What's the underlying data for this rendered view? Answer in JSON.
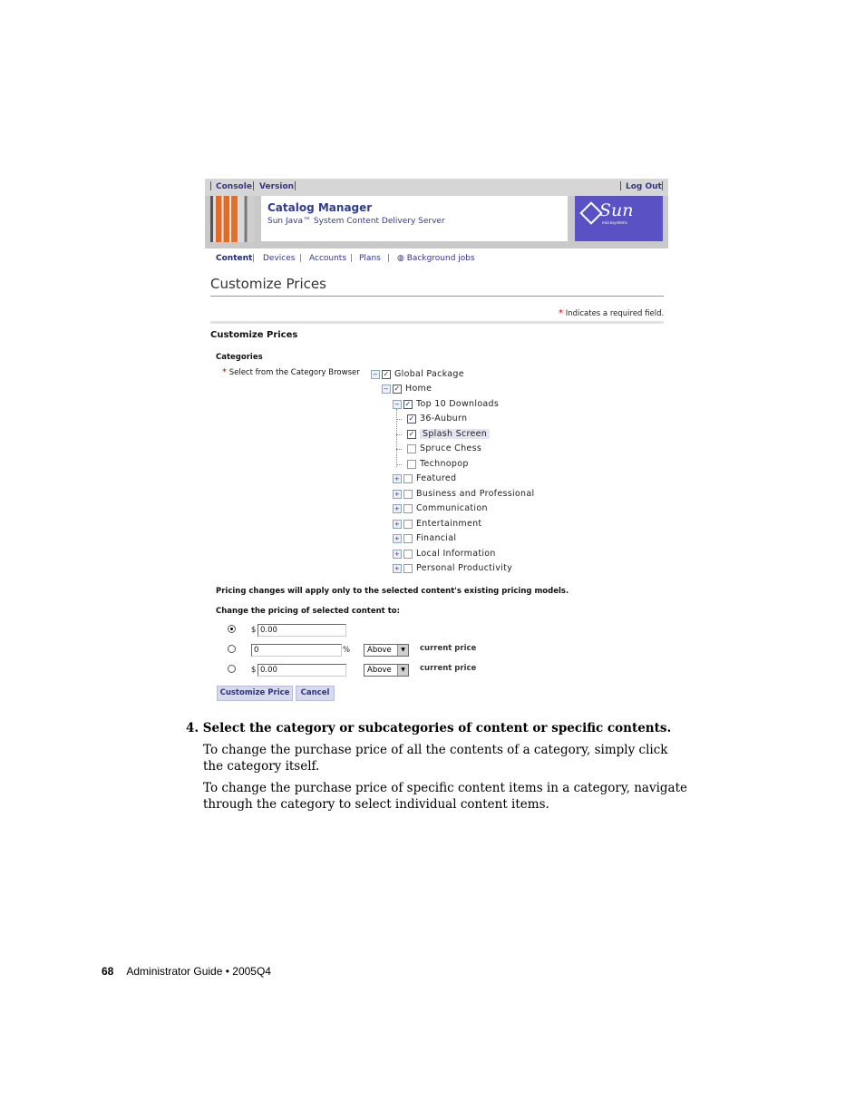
{
  "header": {
    "console": "Console",
    "version": "Version",
    "logout": "Log Out"
  },
  "banner": {
    "title": "Catalog Manager",
    "subtitle": "Sun Java™ System Content Delivery Server",
    "logo_text": "Sun",
    "logo_tiny": "microsystems"
  },
  "nav": [
    "Content",
    "Devices",
    "Accounts",
    "Plans",
    "Background jobs"
  ],
  "page": {
    "title": "Customize Prices",
    "required_note": "Indicates a required field.",
    "section_heading": "Customize Prices",
    "categories_label": "Categories",
    "category_browser_label": "Select from the Category Browser"
  },
  "tree": [
    {
      "label": "Global Package",
      "checked": true,
      "expander": "-"
    },
    {
      "label": "Home",
      "checked": true,
      "expander": "-"
    },
    {
      "label": "Top 10 Downloads",
      "checked": true,
      "expander": "-"
    },
    {
      "label": "36-Auburn",
      "checked": true,
      "expander": ""
    },
    {
      "label": "Splash Screen",
      "checked": true,
      "expander": "",
      "highlighted": true
    },
    {
      "label": "Spruce Chess",
      "checked": false,
      "expander": ""
    },
    {
      "label": "Technopop",
      "checked": false,
      "expander": ""
    },
    {
      "label": "Featured",
      "checked": false,
      "expander": "+"
    },
    {
      "label": "Business and Professional",
      "checked": false,
      "expander": "+"
    },
    {
      "label": "Communication",
      "checked": false,
      "expander": "+"
    },
    {
      "label": "Entertainment",
      "checked": false,
      "expander": "+"
    },
    {
      "label": "Financial",
      "checked": false,
      "expander": "+"
    },
    {
      "label": "Local Information",
      "checked": false,
      "expander": "+"
    },
    {
      "label": "Personal Productivity",
      "checked": false,
      "expander": "+"
    }
  ],
  "pricing": {
    "note": "Pricing changes will apply only to the selected content's existing pricing models.",
    "change_label": "Change the pricing of selected content to:",
    "row1": {
      "currency": "$",
      "value": "0.00",
      "selected": true
    },
    "row2": {
      "value": "0",
      "unit": "%",
      "direction": "Above",
      "suffix": "current price"
    },
    "row3": {
      "currency": "$",
      "value": "0.00",
      "direction": "Above",
      "suffix": "current price"
    }
  },
  "buttons": {
    "customize": "Customize Price",
    "cancel": "Cancel"
  },
  "doc": {
    "step": "4.  Select the category or subcategories of content or specific contents.",
    "para1": "To change the purchase price of all the contents of a category, simply click the category itself.",
    "para2": "To change the purchase price of specific content items in a category, navigate through the category to select individual content items."
  },
  "footer": {
    "page_number": "68",
    "text": "Administrator Guide  •  2005Q4"
  }
}
